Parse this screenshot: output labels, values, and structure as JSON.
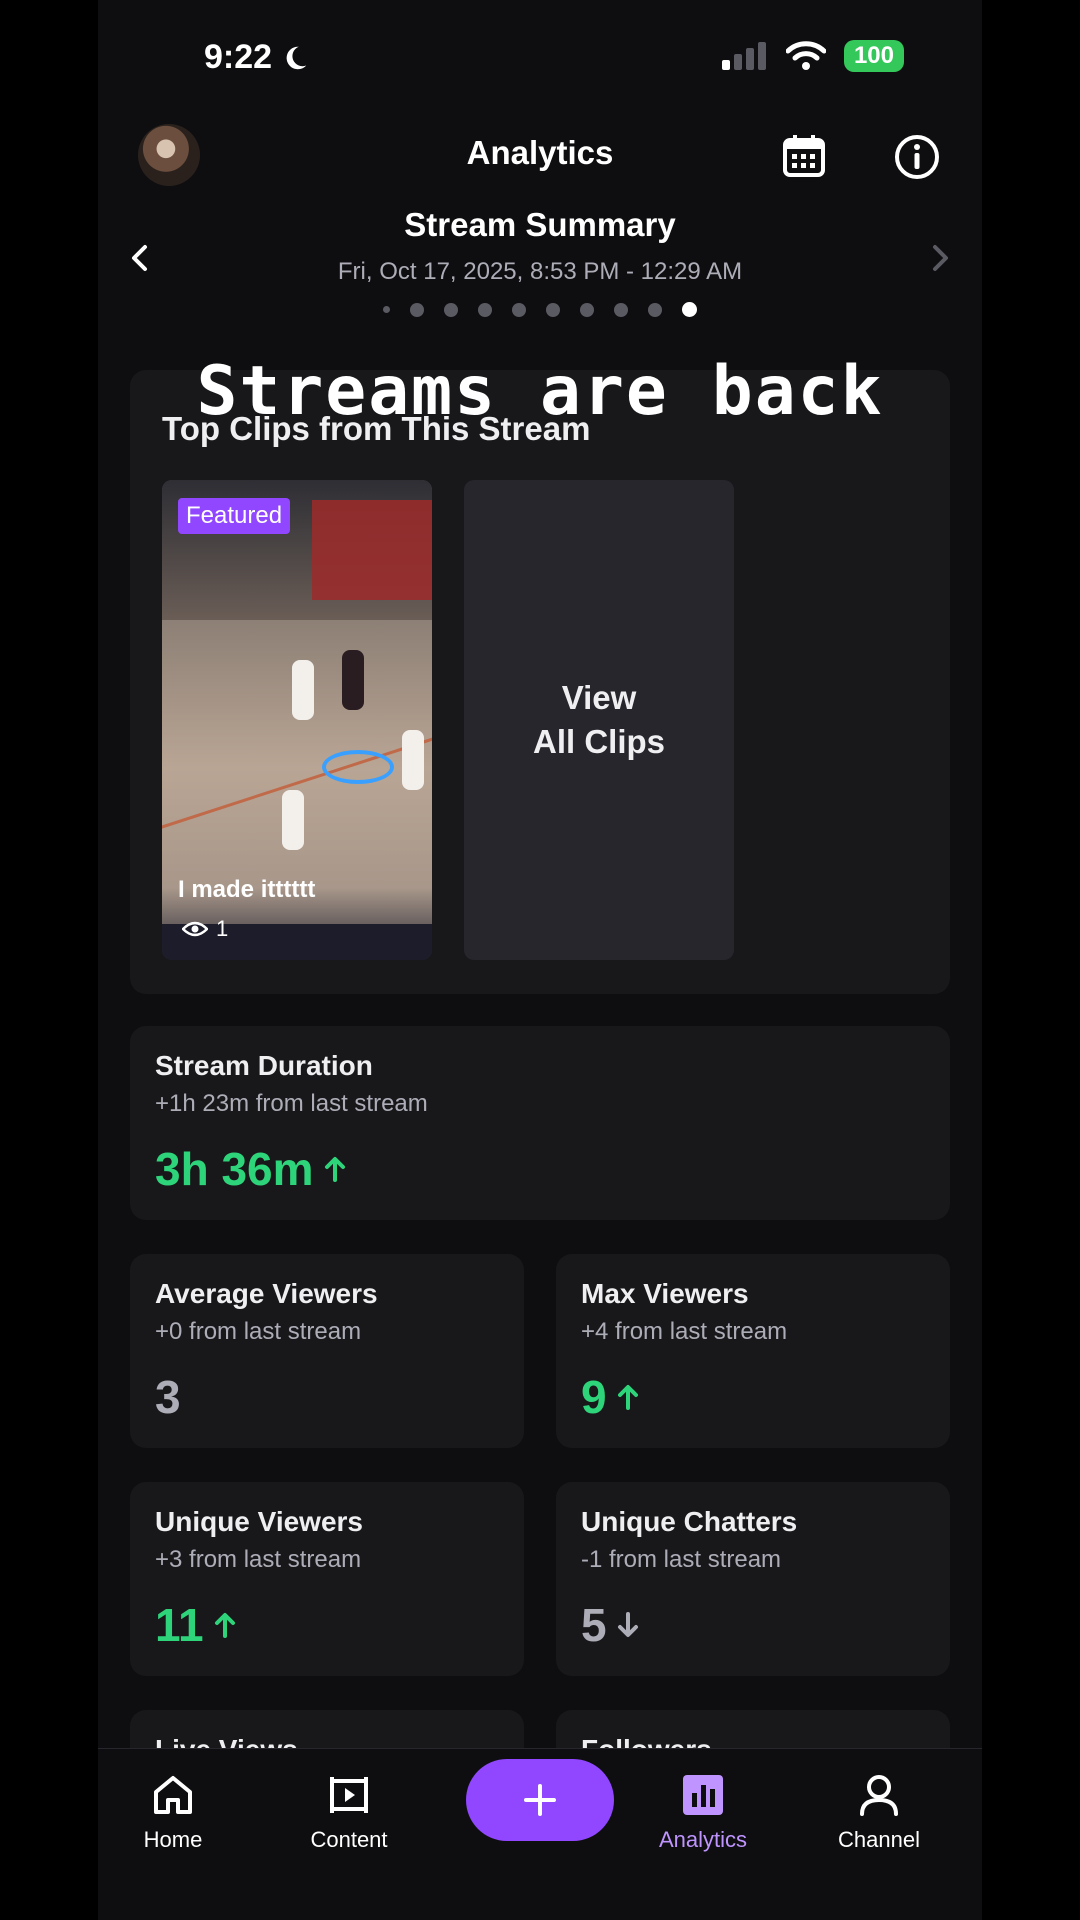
{
  "status_bar": {
    "time": "9:22",
    "battery": "100"
  },
  "header": {
    "title": "Analytics"
  },
  "summary": {
    "title": "Stream Summary",
    "date_range": "Fri, Oct 17, 2025, 8:53 PM - 12:29 AM",
    "page_count": 10,
    "active_page": 10
  },
  "overlay_caption": "Streams are back",
  "clips": {
    "heading": "Top Clips from This Stream",
    "featured_badge": "Featured",
    "clip_title": "I made itttttt",
    "clip_views": "1",
    "view_all_line1": "View",
    "view_all_line2": "All Clips"
  },
  "stats": {
    "duration": {
      "title": "Stream Duration",
      "sub": "+1h 23m from last stream",
      "value": "3h 36m",
      "trend": "up"
    },
    "avg_viewers": {
      "title": "Average Viewers",
      "sub": "+0 from last stream",
      "value": "3",
      "trend": "none"
    },
    "max_viewers": {
      "title": "Max Viewers",
      "sub": "+4 from last stream",
      "value": "9",
      "trend": "up"
    },
    "unique_viewers": {
      "title": "Unique Viewers",
      "sub": "+3 from last stream",
      "value": "11",
      "trend": "up"
    },
    "unique_chatters": {
      "title": "Unique Chatters",
      "sub": "-1 from last stream",
      "value": "5",
      "trend": "down"
    },
    "live_views": {
      "title": "Live Views"
    },
    "followers": {
      "title": "Followers"
    }
  },
  "bottom_nav": {
    "home": "Home",
    "content": "Content",
    "analytics": "Analytics",
    "channel": "Channel"
  },
  "colors": {
    "accent": "#9147ff",
    "positive": "#2ed47a",
    "background": "#0e0e10",
    "card": "#18181b"
  }
}
